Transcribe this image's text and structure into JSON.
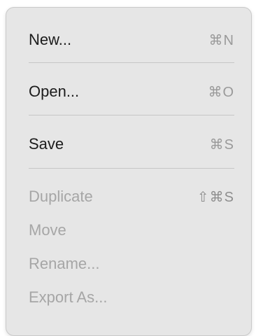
{
  "menu": {
    "items": [
      {
        "label": "New...",
        "shortcut": "⌘N",
        "enabled": true
      },
      {
        "label": "Open...",
        "shortcut": "⌘O",
        "enabled": true
      },
      {
        "label": "Save",
        "shortcut": "⌘S",
        "enabled": true
      },
      {
        "label": "Duplicate",
        "shortcut": "⇧⌘S",
        "enabled": false
      },
      {
        "label": "Move",
        "shortcut": "",
        "enabled": false
      },
      {
        "label": "Rename...",
        "shortcut": "",
        "enabled": false
      },
      {
        "label": "Export As...",
        "shortcut": "",
        "enabled": false
      }
    ]
  },
  "colors": {
    "menu_background": "#e6e6e6",
    "enabled_text": "#1c1c1c",
    "disabled_text": "#a6a6a6",
    "separator": "#c6c6c6"
  }
}
